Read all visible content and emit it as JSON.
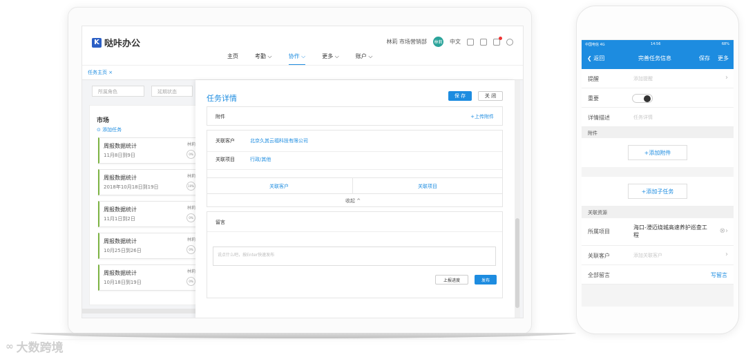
{
  "app": {
    "title": "哒咔办公",
    "logo_mark": "K"
  },
  "nav": {
    "items": [
      {
        "label": "主页"
      },
      {
        "label": "考勤 ⌵"
      },
      {
        "label": "协作 ⌵"
      },
      {
        "label": "更多 ⌵"
      },
      {
        "label": "账户 ⌵"
      }
    ]
  },
  "user": {
    "name": "林莉 市场营销部",
    "avatar": "林莉",
    "lang": "中文"
  },
  "tab": {
    "label": "任务主页 ×"
  },
  "filters": {
    "role": "所属角色",
    "state": "延期状态"
  },
  "list": {
    "title": "市场",
    "add_label": "⊙ 添加任务"
  },
  "tasks": [
    {
      "title": "周报数据统计",
      "date": "11月8日到9日",
      "owner": "林莉",
      "pct": "0%"
    },
    {
      "title": "周报数据统计",
      "date": "2018年10月18日到19日",
      "owner": "林莉",
      "pct": "10%"
    },
    {
      "title": "周报数据统计",
      "date": "11月1日到2日",
      "owner": "林莉",
      "pct": "0%"
    },
    {
      "title": "周报数据统计",
      "date": "10月25日到26日",
      "owner": "林莉",
      "pct": "0%"
    },
    {
      "title": "周报数据统计",
      "date": "10月18日到19日",
      "owner": "林莉",
      "pct": "0%"
    }
  ],
  "panel": {
    "title": "任务详情",
    "save": "保 存",
    "close": "关 闭",
    "attach_label": "附件",
    "upload_label": "+上传附件",
    "customer_label": "关联客户",
    "customer_value": "北京久其云福科技有限公司",
    "project_label": "关联项目",
    "project_value": "行政/其他",
    "tab_customer": "关联客户",
    "tab_project": "关联项目",
    "collapse": "收起 ^",
    "comment_label": "留言",
    "comment_placeholder": "说点什么吧，按Enter快速发布",
    "progress_btn": "上报进度",
    "publish_btn": "发布"
  },
  "phone": {
    "status_left": "中国电信 4G",
    "status_time": "14:56",
    "status_right": "68%",
    "back": "返回",
    "title": "完善任务信息",
    "save": "保存",
    "more": "更多",
    "remind_label": "提醒",
    "remind_value": "添加提醒",
    "important_label": "重要",
    "desc_label": "详情描述",
    "desc_value": "任务详情",
    "attach_header": "附件",
    "add_attach": "+添加附件",
    "add_subtask": "+添加子任务",
    "res_header": "关联资源",
    "project_label": "所属项目",
    "project_value": "海口-澄迈绕城高速养护巡查工程",
    "customer_label": "关联客户",
    "customer_value": "添加关联客户",
    "comments_label": "全部留言",
    "write_comment": "写留言"
  },
  "watermark": {
    "mark": "∞",
    "text": "大数跨境"
  },
  "colors": {
    "accent": "#1d8ce0",
    "card_border": "#7cb342",
    "avatar": "#2aa39a"
  }
}
